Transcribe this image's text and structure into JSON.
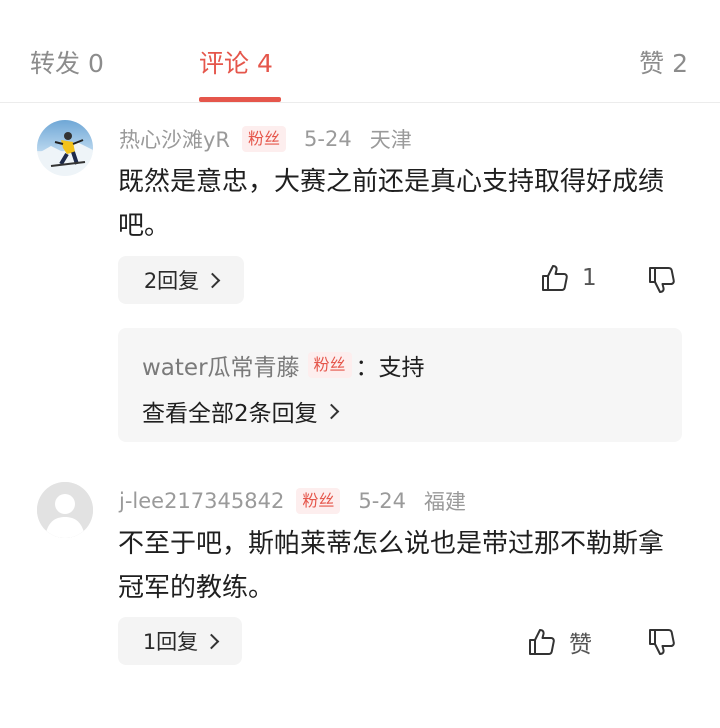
{
  "tabs": {
    "forward": "转发 0",
    "comment": "评论 4",
    "like": "赞 2"
  },
  "comments": [
    {
      "username": "热心沙滩yR",
      "badge": "粉丝",
      "date": "5-24",
      "location": "天津",
      "text": "既然是意忠，大赛之前还是真心支持取得好成绩吧。",
      "reply_btn": "2回复",
      "like_count": "1",
      "avatar_icon": "skier-avatar",
      "replies": {
        "user": "water瓜常青藤",
        "badge": "粉丝",
        "text": "：支持",
        "view_all": "查看全部2条回复"
      }
    },
    {
      "username": "j-lee217345842",
      "badge": "粉丝",
      "date": "5-24",
      "location": "福建",
      "text": "不至于吧，斯帕莱蒂怎么说也是带过那不勒斯拿冠军的教练。",
      "reply_btn": "1回复",
      "like_count": "赞",
      "avatar_icon": "default-user-avatar"
    }
  ],
  "colors": {
    "accent": "#e5564b",
    "muted": "#9a9a9a",
    "reply_bg": "#f6f6f6"
  }
}
